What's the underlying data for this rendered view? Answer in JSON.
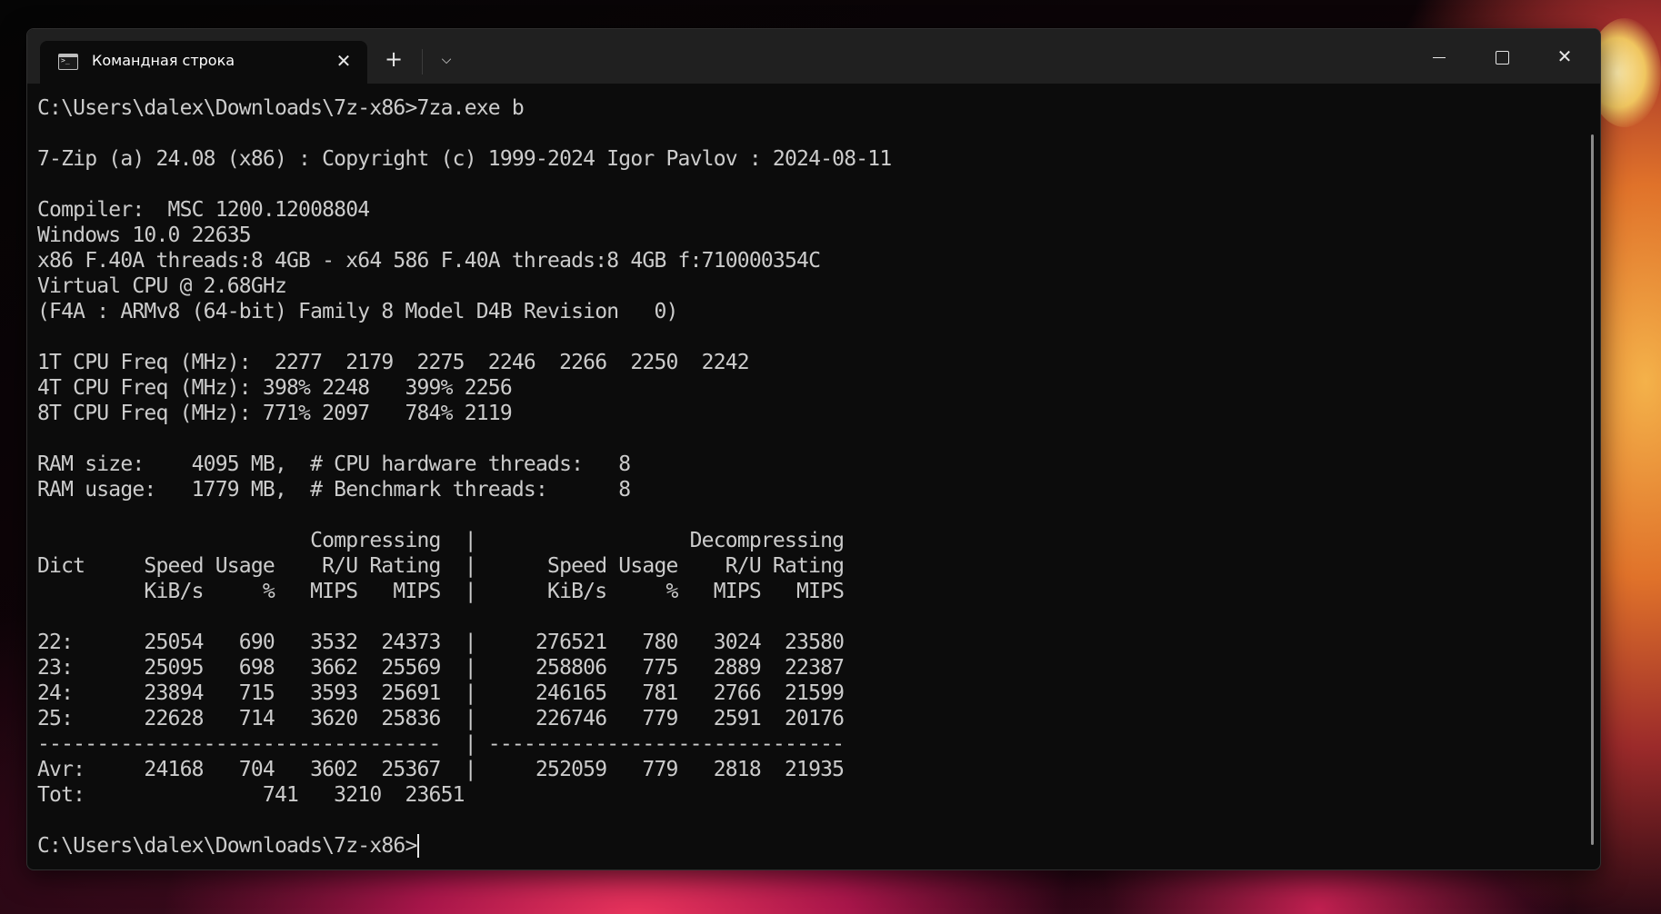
{
  "tab": {
    "title": "Командная строка",
    "icon": "terminal-icon"
  },
  "terminal": {
    "lines": [
      "C:\\Users\\dalex\\Downloads\\7z-x86>7za.exe b",
      "",
      "7-Zip (a) 24.08 (x86) : Copyright (c) 1999-2024 Igor Pavlov : 2024-08-11",
      "",
      "Compiler:  MSC 1200.12008804",
      "Windows 10.0 22635",
      "x86 F.40A threads:8 4GB - x64 586 F.40A threads:8 4GB f:710000354C",
      "Virtual CPU @ 2.68GHz",
      "(F4A : ARMv8 (64-bit) Family 8 Model D4B Revision   0)",
      "",
      "1T CPU Freq (MHz):  2277  2179  2275  2246  2266  2250  2242",
      "4T CPU Freq (MHz): 398% 2248   399% 2256",
      "8T CPU Freq (MHz): 771% 2097   784% 2119",
      "",
      "RAM size:    4095 MB,  # CPU hardware threads:   8",
      "RAM usage:   1779 MB,  # Benchmark threads:      8",
      "",
      "                       Compressing  |                  Decompressing",
      "Dict     Speed Usage    R/U Rating  |      Speed Usage    R/U Rating",
      "         KiB/s     %   MIPS   MIPS  |      KiB/s     %   MIPS   MIPS",
      "",
      "22:      25054   690   3532  24373  |     276521   780   3024  23580",
      "23:      25095   698   3662  25569  |     258806   775   2889  22387",
      "24:      23894   715   3593  25691  |     246165   781   2766  21599",
      "25:      22628   714   3620  25836  |     226746   779   2591  20176",
      "----------------------------------  | ------------------------------",
      "Avr:     24168   704   3602  25367  |     252059   779   2818  21935",
      "Tot:               741   3210  23651",
      ""
    ],
    "prompt": "C:\\Users\\dalex\\Downloads\\7z-x86>"
  }
}
